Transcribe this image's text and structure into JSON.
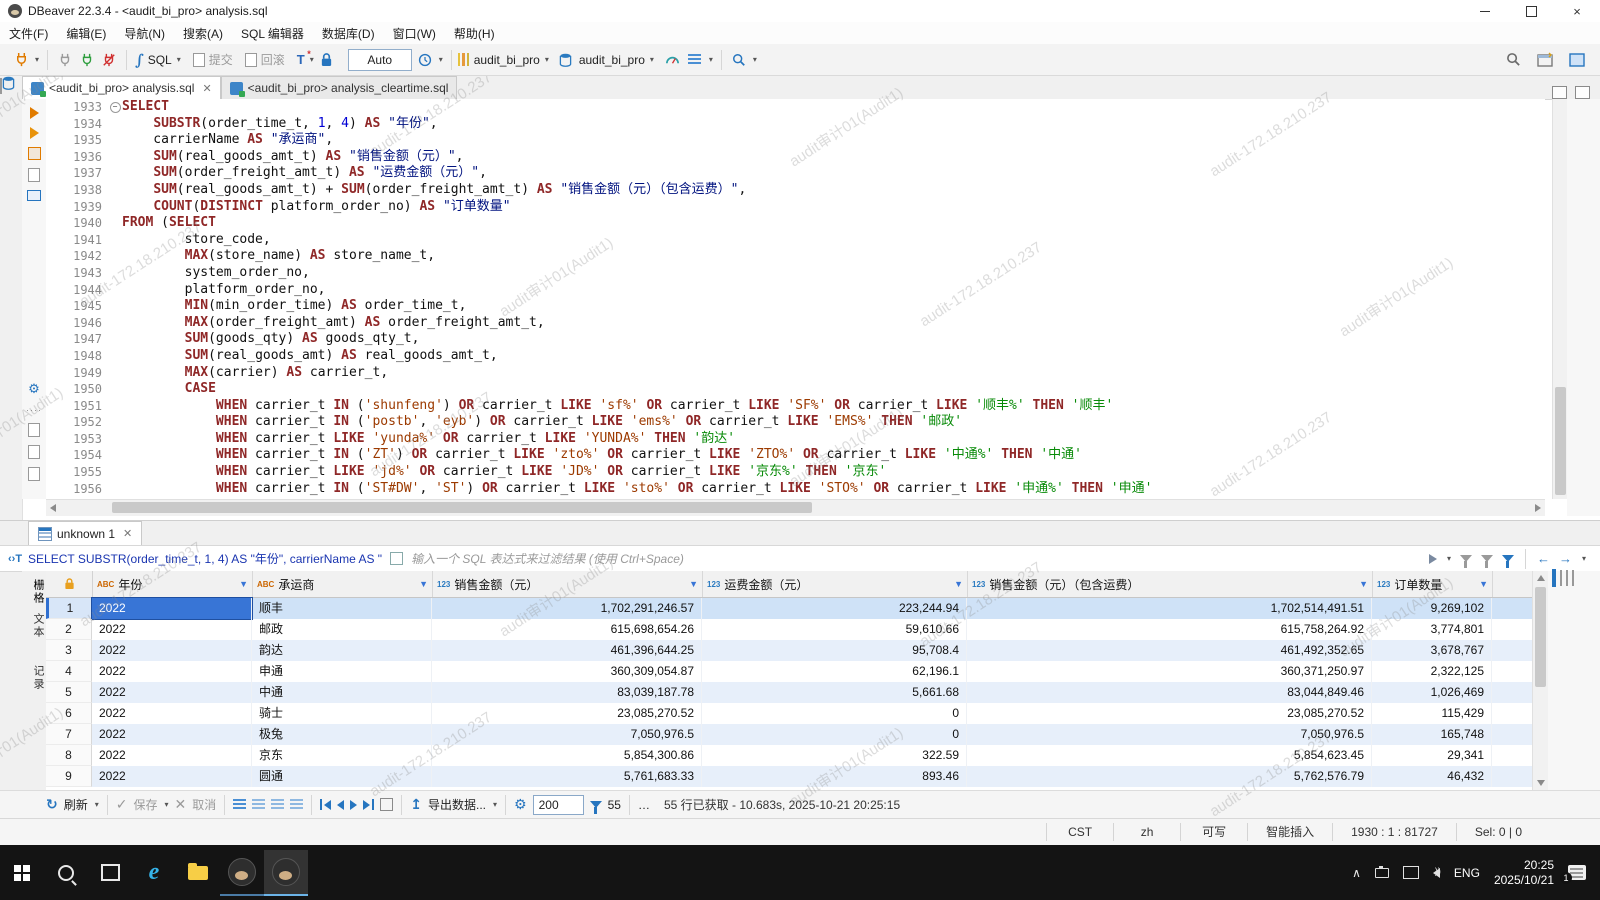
{
  "window": {
    "title": "DBeaver 22.3.4 - <audit_bi_pro> analysis.sql",
    "minimize": "–",
    "close": "×"
  },
  "menu": {
    "items": [
      "文件(F)",
      "编辑(E)",
      "导航(N)",
      "搜索(A)",
      "SQL 编辑器",
      "数据库(D)",
      "窗口(W)",
      "帮助(H)"
    ]
  },
  "toolbar": {
    "sql_label": "SQL",
    "commit_label": "提交",
    "rollback_label": "回滚",
    "tx_mode": "Auto",
    "connection_name": "audit_bi_pro",
    "database_name": "audit_bi_pro"
  },
  "editor_tabs": [
    {
      "label": "<audit_bi_pro> analysis.sql"
    },
    {
      "label": "<audit_bi_pro> analysis_cleartime.sql"
    }
  ],
  "editor": {
    "lines": [
      {
        "no": "1933",
        "fold": true,
        "segs": [
          [
            "k",
            "SELECT"
          ]
        ]
      },
      {
        "no": "1934",
        "segs": [
          [
            "t",
            "    "
          ],
          [
            "k",
            "SUBSTR"
          ],
          [
            "t",
            "(order_time_t, "
          ],
          [
            "n",
            "1"
          ],
          [
            "t",
            ", "
          ],
          [
            "n",
            "4"
          ],
          [
            "t",
            ") "
          ],
          [
            "k",
            "AS"
          ],
          [
            "t",
            " "
          ],
          [
            "q",
            "\"年份\""
          ],
          [
            "t",
            ","
          ]
        ]
      },
      {
        "no": "1935",
        "segs": [
          [
            "t",
            "    carrierName "
          ],
          [
            "k",
            "AS"
          ],
          [
            "t",
            " "
          ],
          [
            "q",
            "\"承运商\""
          ],
          [
            "t",
            ","
          ]
        ]
      },
      {
        "no": "1936",
        "segs": [
          [
            "t",
            "    "
          ],
          [
            "k",
            "SUM"
          ],
          [
            "t",
            "(real_goods_amt_t) "
          ],
          [
            "k",
            "AS"
          ],
          [
            "t",
            " "
          ],
          [
            "q",
            "\"销售金额（元）\""
          ],
          [
            "t",
            ","
          ]
        ]
      },
      {
        "no": "1937",
        "segs": [
          [
            "t",
            "    "
          ],
          [
            "k",
            "SUM"
          ],
          [
            "t",
            "(order_freight_amt_t) "
          ],
          [
            "k",
            "AS"
          ],
          [
            "t",
            " "
          ],
          [
            "q",
            "\"运费金额（元）\""
          ],
          [
            "t",
            ","
          ]
        ]
      },
      {
        "no": "1938",
        "segs": [
          [
            "t",
            "    "
          ],
          [
            "k",
            "SUM"
          ],
          [
            "t",
            "(real_goods_amt_t) + "
          ],
          [
            "k",
            "SUM"
          ],
          [
            "t",
            "(order_freight_amt_t) "
          ],
          [
            "k",
            "AS"
          ],
          [
            "t",
            " "
          ],
          [
            "q",
            "\"销售金额（元）（包含运费）\""
          ],
          [
            "t",
            ","
          ]
        ]
      },
      {
        "no": "1939",
        "segs": [
          [
            "t",
            "    "
          ],
          [
            "k",
            "COUNT"
          ],
          [
            "t",
            "("
          ],
          [
            "k",
            "DISTINCT"
          ],
          [
            "t",
            " platform_order_no) "
          ],
          [
            "k",
            "AS"
          ],
          [
            "t",
            " "
          ],
          [
            "q",
            "\"订单数量\""
          ]
        ]
      },
      {
        "no": "1940",
        "segs": [
          [
            "k",
            "FROM"
          ],
          [
            "t",
            " ("
          ],
          [
            "k",
            "SELECT"
          ]
        ]
      },
      {
        "no": "1941",
        "segs": [
          [
            "t",
            "        store_code,"
          ]
        ]
      },
      {
        "no": "1942",
        "segs": [
          [
            "t",
            "        "
          ],
          [
            "k",
            "MAX"
          ],
          [
            "t",
            "(store_name) "
          ],
          [
            "k",
            "AS"
          ],
          [
            "t",
            " store_name_t,"
          ]
        ]
      },
      {
        "no": "1943",
        "segs": [
          [
            "t",
            "        system_order_no,"
          ]
        ]
      },
      {
        "no": "1944",
        "segs": [
          [
            "t",
            "        platform_order_no,"
          ]
        ]
      },
      {
        "no": "1945",
        "segs": [
          [
            "t",
            "        "
          ],
          [
            "k",
            "MIN"
          ],
          [
            "t",
            "(min_order_time) "
          ],
          [
            "k",
            "AS"
          ],
          [
            "t",
            " order_time_t,"
          ]
        ]
      },
      {
        "no": "1946",
        "segs": [
          [
            "t",
            "        "
          ],
          [
            "k",
            "MAX"
          ],
          [
            "t",
            "(order_freight_amt) "
          ],
          [
            "k",
            "AS"
          ],
          [
            "t",
            " order_freight_amt_t,"
          ]
        ]
      },
      {
        "no": "1947",
        "segs": [
          [
            "t",
            "        "
          ],
          [
            "k",
            "SUM"
          ],
          [
            "t",
            "(goods_qty) "
          ],
          [
            "k",
            "AS"
          ],
          [
            "t",
            " goods_qty_t,"
          ]
        ]
      },
      {
        "no": "1948",
        "segs": [
          [
            "t",
            "        "
          ],
          [
            "k",
            "SUM"
          ],
          [
            "t",
            "(real_goods_amt) "
          ],
          [
            "k",
            "AS"
          ],
          [
            "t",
            " real_goods_amt_t,"
          ]
        ]
      },
      {
        "no": "1949",
        "segs": [
          [
            "t",
            "        "
          ],
          [
            "k",
            "MAX"
          ],
          [
            "t",
            "(carrier) "
          ],
          [
            "k",
            "AS"
          ],
          [
            "t",
            " carrier_t,"
          ]
        ]
      },
      {
        "no": "1950",
        "segs": [
          [
            "t",
            "        "
          ],
          [
            "k",
            "CASE"
          ]
        ]
      },
      {
        "no": "1951",
        "segs": [
          [
            "t",
            "            "
          ],
          [
            "k",
            "WHEN"
          ],
          [
            "t",
            " carrier_t "
          ],
          [
            "k",
            "IN"
          ],
          [
            "t",
            " ("
          ],
          [
            "s",
            "'shunfeng'"
          ],
          [
            "t",
            ") "
          ],
          [
            "k",
            "OR"
          ],
          [
            "t",
            " carrier_t "
          ],
          [
            "k",
            "LIKE"
          ],
          [
            "t",
            " "
          ],
          [
            "s",
            "'sf%'"
          ],
          [
            "t",
            " "
          ],
          [
            "k",
            "OR"
          ],
          [
            "t",
            " carrier_t "
          ],
          [
            "k",
            "LIKE"
          ],
          [
            "t",
            " "
          ],
          [
            "s",
            "'SF%'"
          ],
          [
            "t",
            " "
          ],
          [
            "k",
            "OR"
          ],
          [
            "t",
            " carrier_t "
          ],
          [
            "k",
            "LIKE"
          ],
          [
            "t",
            " "
          ],
          [
            "g",
            "'顺丰%'"
          ],
          [
            "t",
            " "
          ],
          [
            "k",
            "THEN"
          ],
          [
            "t",
            " "
          ],
          [
            "g",
            "'顺丰'"
          ]
        ]
      },
      {
        "no": "1952",
        "segs": [
          [
            "t",
            "            "
          ],
          [
            "k",
            "WHEN"
          ],
          [
            "t",
            " carrier_t "
          ],
          [
            "k",
            "IN"
          ],
          [
            "t",
            " ("
          ],
          [
            "s",
            "'postb'"
          ],
          [
            "t",
            ", "
          ],
          [
            "s",
            "'eyb'"
          ],
          [
            "t",
            ") "
          ],
          [
            "k",
            "OR"
          ],
          [
            "t",
            " carrier_t "
          ],
          [
            "k",
            "LIKE"
          ],
          [
            "t",
            " "
          ],
          [
            "s",
            "'ems%'"
          ],
          [
            "t",
            " "
          ],
          [
            "k",
            "OR"
          ],
          [
            "t",
            " carrier_t "
          ],
          [
            "k",
            "LIKE"
          ],
          [
            "t",
            " "
          ],
          [
            "s",
            "'EMS%'"
          ],
          [
            "t",
            " "
          ],
          [
            "k",
            "THEN"
          ],
          [
            "t",
            " "
          ],
          [
            "g",
            "'邮政'"
          ]
        ]
      },
      {
        "no": "1953",
        "segs": [
          [
            "t",
            "            "
          ],
          [
            "k",
            "WHEN"
          ],
          [
            "t",
            " carrier_t "
          ],
          [
            "k",
            "LIKE"
          ],
          [
            "t",
            " "
          ],
          [
            "s",
            "'yunda%'"
          ],
          [
            "t",
            " "
          ],
          [
            "k",
            "OR"
          ],
          [
            "t",
            " carrier_t "
          ],
          [
            "k",
            "LIKE"
          ],
          [
            "t",
            " "
          ],
          [
            "s",
            "'YUNDA%'"
          ],
          [
            "t",
            " "
          ],
          [
            "k",
            "THEN"
          ],
          [
            "t",
            " "
          ],
          [
            "g",
            "'韵达'"
          ]
        ]
      },
      {
        "no": "1954",
        "segs": [
          [
            "t",
            "            "
          ],
          [
            "k",
            "WHEN"
          ],
          [
            "t",
            " carrier_t "
          ],
          [
            "k",
            "IN"
          ],
          [
            "t",
            " ("
          ],
          [
            "s",
            "'ZT'"
          ],
          [
            "t",
            ") "
          ],
          [
            "k",
            "OR"
          ],
          [
            "t",
            " carrier_t "
          ],
          [
            "k",
            "LIKE"
          ],
          [
            "t",
            " "
          ],
          [
            "s",
            "'zto%'"
          ],
          [
            "t",
            " "
          ],
          [
            "k",
            "OR"
          ],
          [
            "t",
            " carrier_t "
          ],
          [
            "k",
            "LIKE"
          ],
          [
            "t",
            " "
          ],
          [
            "s",
            "'ZTO%'"
          ],
          [
            "t",
            " "
          ],
          [
            "k",
            "OR"
          ],
          [
            "t",
            " carrier_t "
          ],
          [
            "k",
            "LIKE"
          ],
          [
            "t",
            " "
          ],
          [
            "g",
            "'中通%'"
          ],
          [
            "t",
            " "
          ],
          [
            "k",
            "THEN"
          ],
          [
            "t",
            " "
          ],
          [
            "g",
            "'中通'"
          ]
        ]
      },
      {
        "no": "1955",
        "segs": [
          [
            "t",
            "            "
          ],
          [
            "k",
            "WHEN"
          ],
          [
            "t",
            " carrier_t "
          ],
          [
            "k",
            "LIKE"
          ],
          [
            "t",
            " "
          ],
          [
            "s",
            "'jd%'"
          ],
          [
            "t",
            " "
          ],
          [
            "k",
            "OR"
          ],
          [
            "t",
            " carrier_t "
          ],
          [
            "k",
            "LIKE"
          ],
          [
            "t",
            " "
          ],
          [
            "s",
            "'JD%'"
          ],
          [
            "t",
            " "
          ],
          [
            "k",
            "OR"
          ],
          [
            "t",
            " carrier_t "
          ],
          [
            "k",
            "LIKE"
          ],
          [
            "t",
            " "
          ],
          [
            "g",
            "'京东%'"
          ],
          [
            "t",
            " "
          ],
          [
            "k",
            "THEN"
          ],
          [
            "t",
            " "
          ],
          [
            "g",
            "'京东'"
          ]
        ]
      },
      {
        "no": "1956",
        "segs": [
          [
            "t",
            "            "
          ],
          [
            "k",
            "WHEN"
          ],
          [
            "t",
            " carrier_t "
          ],
          [
            "k",
            "IN"
          ],
          [
            "t",
            " ("
          ],
          [
            "s",
            "'ST#DW'"
          ],
          [
            "t",
            ", "
          ],
          [
            "s",
            "'ST'"
          ],
          [
            "t",
            ") "
          ],
          [
            "k",
            "OR"
          ],
          [
            "t",
            " carrier_t "
          ],
          [
            "k",
            "LIKE"
          ],
          [
            "t",
            " "
          ],
          [
            "s",
            "'sto%'"
          ],
          [
            "t",
            " "
          ],
          [
            "k",
            "OR"
          ],
          [
            "t",
            " carrier_t "
          ],
          [
            "k",
            "LIKE"
          ],
          [
            "t",
            " "
          ],
          [
            "s",
            "'STO%'"
          ],
          [
            "t",
            " "
          ],
          [
            "k",
            "OR"
          ],
          [
            "t",
            " carrier_t "
          ],
          [
            "k",
            "LIKE"
          ],
          [
            "t",
            " "
          ],
          [
            "g",
            "'申通%'"
          ],
          [
            "t",
            " "
          ],
          [
            "k",
            "THEN"
          ],
          [
            "t",
            " "
          ],
          [
            "g",
            "'申通'"
          ]
        ]
      }
    ]
  },
  "results": {
    "tab_label": "unknown 1",
    "filter_query": "SELECT SUBSTR(order_time_t, 1, 4) AS \"年份\", carrierName AS \"",
    "filter_placeholder": "输入一个 SQL 表达式来过滤结果 (使用 Ctrl+Space)",
    "side_tabs": [
      "栅格",
      "文本",
      "记录"
    ],
    "grid": {
      "columns": [
        {
          "type": "ABC",
          "label": "年份"
        },
        {
          "type": "ABC",
          "label": "承运商"
        },
        {
          "type": "123",
          "label": "销售金额（元）"
        },
        {
          "type": "123",
          "label": "运费金额（元）"
        },
        {
          "type": "123",
          "label": "销售金额（元）（包含运费）"
        },
        {
          "type": "123",
          "label": "订单数量"
        }
      ],
      "rows": [
        [
          "2022",
          "顺丰",
          "1,702,291,246.57",
          "223,244.94",
          "1,702,514,491.51",
          "9,269,102"
        ],
        [
          "2022",
          "邮政",
          "615,698,654.26",
          "59,610.66",
          "615,758,264.92",
          "3,774,801"
        ],
        [
          "2022",
          "韵达",
          "461,396,644.25",
          "95,708.4",
          "461,492,352.65",
          "3,678,767"
        ],
        [
          "2022",
          "申通",
          "360,309,054.87",
          "62,196.1",
          "360,371,250.97",
          "2,322,125"
        ],
        [
          "2022",
          "中通",
          "83,039,187.78",
          "5,661.68",
          "83,044,849.46",
          "1,026,469"
        ],
        [
          "2022",
          "骑士",
          "23,085,270.52",
          "0",
          "23,085,270.52",
          "115,429"
        ],
        [
          "2022",
          "极兔",
          "7,050,976.5",
          "0",
          "7,050,976.5",
          "165,748"
        ],
        [
          "2022",
          "京东",
          "5,854,300.86",
          "322.59",
          "5,854,623.45",
          "29,341"
        ],
        [
          "2022",
          "圆通",
          "5,761,683.33",
          "893.46",
          "5,762,576.79",
          "46,432"
        ]
      ]
    },
    "toolbar": {
      "refresh_label": "刷新",
      "save_label": "保存",
      "cancel_label": "取消",
      "export_label": "导出数据...",
      "fetch_size": "200",
      "row_count": "55",
      "ellipsis": "…",
      "status": "55 行已获取 - 10.683s, 2025-10-21 20:25:15"
    }
  },
  "statusbar": {
    "items": [
      "CST",
      "zh",
      "可写",
      "智能插入",
      "1930 : 1 : 81727",
      "Sel: 0 | 0"
    ]
  },
  "taskbar": {
    "language": "ENG",
    "time": "20:25",
    "date": "2025/10/21",
    "notification_badge": "1"
  },
  "watermarks": [
    "audit审计01(Audit1)",
    "audit-172.18.210.237"
  ]
}
